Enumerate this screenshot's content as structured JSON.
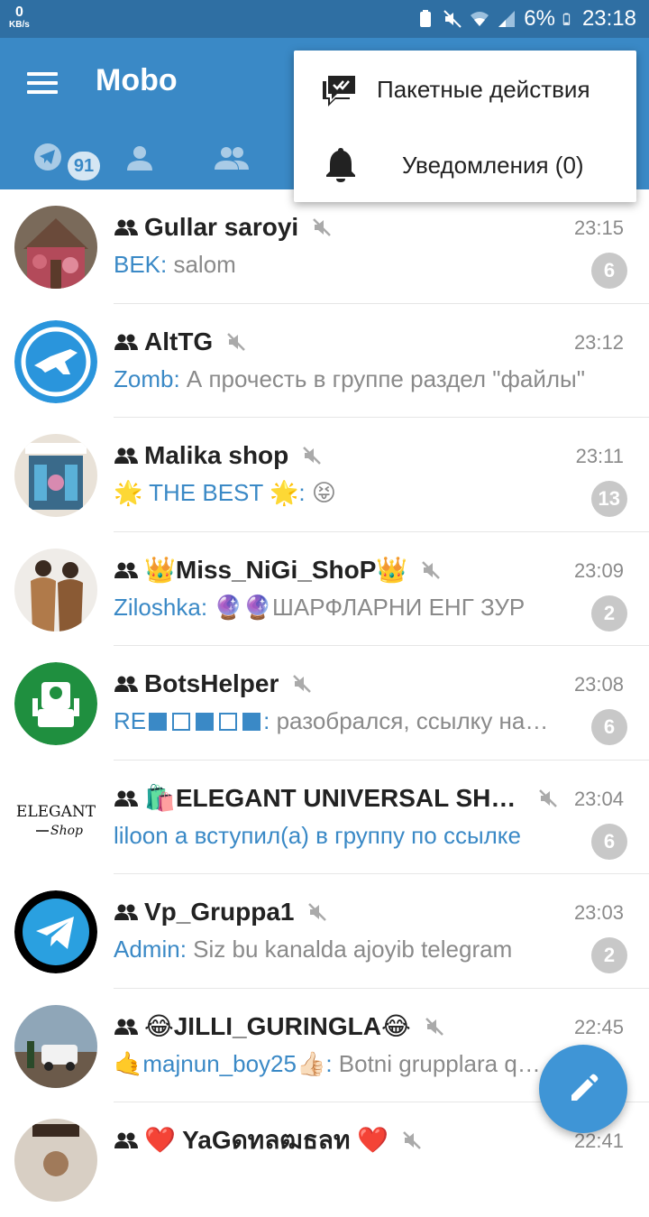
{
  "status_bar": {
    "speed_value": "0",
    "speed_unit": "KB/s",
    "battery": "6%",
    "time": "23:18"
  },
  "app_bar": {
    "title": "Mobo"
  },
  "tabs": {
    "all_badge": "91"
  },
  "menu": {
    "batch_actions": "Пакетные действия",
    "notifications": "Уведомления (0)"
  },
  "chats": [
    {
      "name": "Gullar saroyi",
      "time": "23:15",
      "sender": "BEK:",
      "message": " salom",
      "count": "6"
    },
    {
      "name": "AltTG",
      "time": "23:12",
      "sender": "Zomb:",
      "message": " А прочесть в группе раздел \"файлы\"",
      "count": ""
    },
    {
      "name": "Malika shop",
      "time": "23:11",
      "sender": "🌟 THE BEST 🌟:",
      "message": " 😝",
      "count": "13"
    },
    {
      "name": "👑Miss_NiGi_ShoP👑",
      "time": "23:09",
      "sender": "Ziloshka:",
      "message": " 🔮🔮ШАРФЛАРНИ ЕНГ ЗУР",
      "count": "2"
    },
    {
      "name": "BotsHelper",
      "time": "23:08",
      "sender_prefix": "RE",
      "sender_suffix": ":",
      "message": " разобрался, ссылку нашёл",
      "count": "6"
    },
    {
      "name": "🛍️ELEGANT UNIVERSAL SHOP",
      "time": "23:04",
      "service_message": "liloon а вступил(а) в группу по ссылке",
      "count": "6"
    },
    {
      "name": "Vp_Gruppa1",
      "time": "23:03",
      "sender": "Admin:",
      "message": " Siz bu kanalda ajoyib telegram",
      "count": "2"
    },
    {
      "name": "😂JILLI_GURINGLA😂",
      "time": "22:45",
      "sender": "🤙majnun_boy25👍🏻:",
      "message": " Botni grupplara qo'shing",
      "count": ""
    },
    {
      "name": "❤️ YaGดทลฒธลท ❤️",
      "time": "22:41",
      "sender": "",
      "message": "",
      "count": ""
    }
  ],
  "colors": {
    "appbar": "#3a89c6",
    "statusbar": "#2f6fa3",
    "accent": "#3a89c6",
    "badge_muted": "#c8c8c8",
    "fab": "#3f95d6"
  },
  "icons": [
    "menu-icon",
    "chat-bubble-icon",
    "user-icon",
    "group-icon",
    "batch-actions-icon",
    "bell-icon",
    "mute-icon",
    "pencil-icon"
  ]
}
